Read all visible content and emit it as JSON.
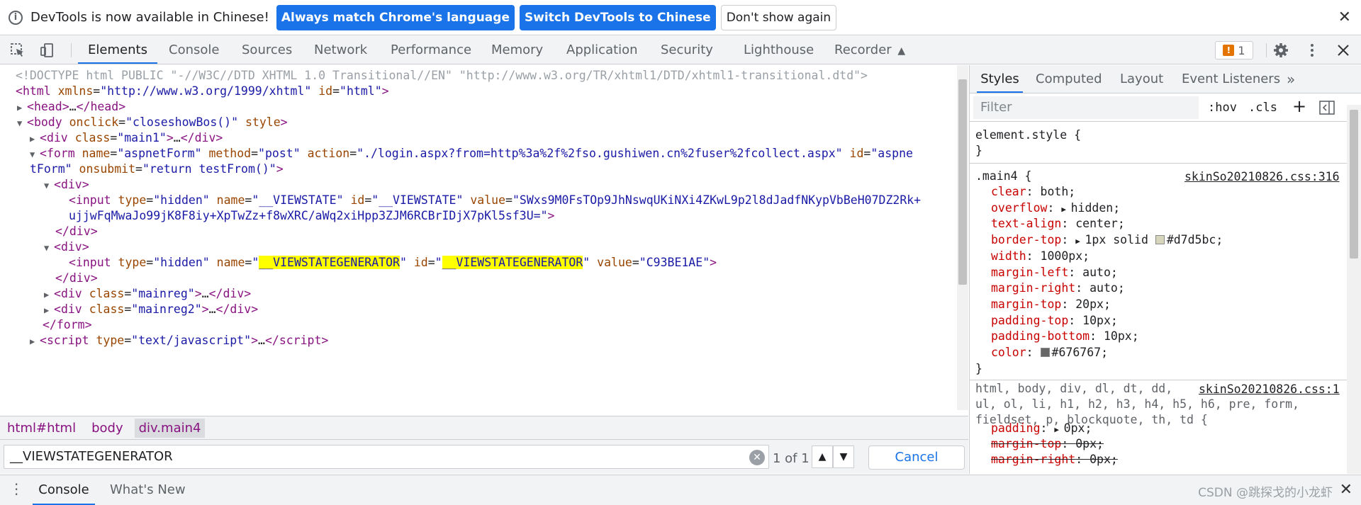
{
  "infobar": {
    "message": "DevTools is now available in Chinese!",
    "btn_match": "Always match Chrome's language",
    "btn_switch": "Switch DevTools to Chinese",
    "btn_dismiss": "Don't show again"
  },
  "tabs": {
    "elements": "Elements",
    "console": "Console",
    "sources": "Sources",
    "network": "Network",
    "performance": "Performance",
    "memory": "Memory",
    "application": "Application",
    "security": "Security",
    "lighthouse": "Lighthouse",
    "recorder": "Recorder",
    "issues_count": "1"
  },
  "dom": {
    "doctype": "<!DOCTYPE html PUBLIC \"-//W3C//DTD XHTML 1.0 Transitional//EN\" \"http://www.w3.org/TR/xhtml1/DTD/xhtml1-transitional.dtd\">",
    "html_tag": "html",
    "html_xmlns_attr": "xmlns",
    "html_xmlns_val": "http://www.w3.org/1999/xhtml",
    "html_id_attr": "id",
    "html_id_val": "html",
    "head_tag": "head",
    "body_tag": "body",
    "body_onclick_attr": "onclick",
    "body_onclick_val": "closeshowBos()",
    "body_style_attr": "style",
    "div_tag": "div",
    "class_attr": "class",
    "main1_val": "main1",
    "form_tag": "form",
    "name_attr": "name",
    "form_name_val": "aspnetForm",
    "method_attr": "method",
    "form_method_val": "post",
    "action_attr": "action",
    "form_action_val": "./login.aspx?from=http%3a%2f%2fso.gushiwen.cn%2fuser%2fcollect.aspx",
    "id_attr": "id",
    "form_id_val_1": "aspne",
    "form_id_val_2": "tForm",
    "onsubmit_attr": "onsubmit",
    "form_onsubmit_val": "return testFrom()",
    "input_tag": "input",
    "type_attr": "type",
    "hidden_val": "hidden",
    "viewstate_val": "__VIEWSTATE",
    "value_attr": "value",
    "viewstate_value_1": "SWxs9M0FsTOp9JhNswqUKiNXi4ZKwL9p2l8dJadfNKypVbBeH07DZ2Rk+",
    "viewstate_value_2": "ujjwFqMwaJo99jK8F8iy+XpTwZz+f8wXRC/aWq2xiHpp3ZJM6RCBrIDjX7pKl5sf3U=",
    "vsgen_val": "__VIEWSTATEGENERATOR",
    "vsgen_value": "C93BE1AE",
    "mainreg_val": "mainreg",
    "mainreg2_val": "mainreg2",
    "script_tag": "script",
    "script_type_val": "text/javascript",
    "ellipsis": "…"
  },
  "breadcrumb": [
    "html#html",
    "body",
    "div.main4"
  ],
  "search": {
    "query": "__VIEWSTATEGENERATOR",
    "match_count": "1 of 1",
    "cancel_label": "Cancel"
  },
  "styles": {
    "tabs": [
      "Styles",
      "Computed",
      "Layout",
      "Event Listeners"
    ],
    "filter_placeholder": "Filter",
    "hov": ":hov",
    "cls": ".cls",
    "element_style": "element.style {",
    "close_brace": "}",
    "rule1_selector": ".main4 {",
    "rule1_source": "skinSo20210826.css:316",
    "rule1_props": [
      {
        "name": "clear",
        "value": "both;"
      },
      {
        "name": "overflow",
        "value": "hidden;"
      },
      {
        "name": "text-align",
        "value": "center;"
      },
      {
        "name": "border-top",
        "value": "1px solid ",
        "swatch": "#d7d5bc",
        "swatch_text": "#d7d5bc;"
      },
      {
        "name": "width",
        "value": "1000px;"
      },
      {
        "name": "margin-left",
        "value": "auto;"
      },
      {
        "name": "margin-right",
        "value": "auto;"
      },
      {
        "name": "margin-top",
        "value": "20px;"
      },
      {
        "name": "padding-top",
        "value": "10px;"
      },
      {
        "name": "padding-bottom",
        "value": "10px;"
      },
      {
        "name": "color",
        "value": "",
        "swatch": "#676767",
        "swatch_text": "#676767;"
      }
    ],
    "rule2_selector_1": "html, body, div, dl, dt, dd,",
    "rule2_selector_2": "ul, ol, li, h1, h2, h3, h4, h5, h6, pre, form,",
    "rule2_selector_3": "fieldset, p, blockquote, th, td {",
    "rule2_source": "skinSo20210826.css:1",
    "rule2_props": [
      {
        "name": "padding",
        "value": "0px;"
      },
      {
        "name": "margin-top",
        "value": "0px;"
      },
      {
        "name": "margin-right",
        "value": "0px;"
      }
    ]
  },
  "drawer": {
    "console": "Console",
    "whats_new": "What's New",
    "watermark": "CSDN @跳探戈的小龙虾"
  },
  "colors": {
    "accent": "#1a73e8",
    "tag": "#881280",
    "attr": "#994500",
    "value": "#1a1aa6",
    "highlight": "#ffff00"
  }
}
